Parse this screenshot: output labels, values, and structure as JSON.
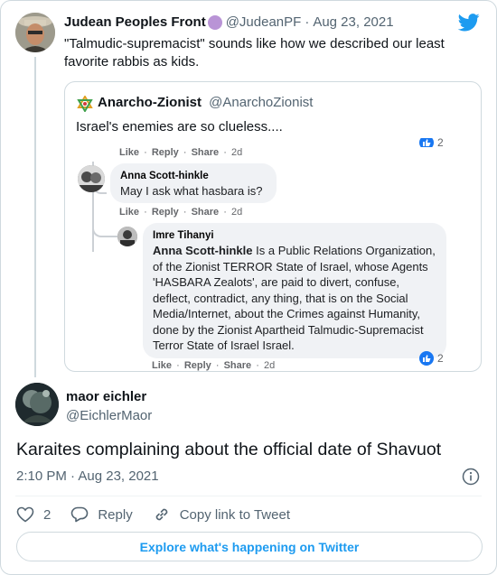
{
  "parent_tweet": {
    "name": "Judean Peoples Front",
    "handle": "@JudeanPF",
    "separator": "·",
    "date": "Aug 23, 2021",
    "text": "\"Talmudic-supremacist\" sounds like how we described our least favorite rabbis as kids."
  },
  "quoted": {
    "name": "Anarcho-Zionist",
    "handle": "@AnarchoZionist",
    "text": "Israel's enemies are so clueless....",
    "meta1": {
      "like": "Like",
      "reply": "Reply",
      "share": "Share",
      "sep": "·",
      "age": "2d"
    },
    "reaction1_count": "2",
    "comment1": {
      "author": "Anna Scott-hinkle",
      "text": "May I ask what hasbara is?",
      "meta": {
        "like": "Like",
        "reply": "Reply",
        "share": "Share",
        "sep": "·",
        "age": "2d"
      }
    },
    "comment2": {
      "author": "Imre Tihanyi",
      "mention": "Anna Scott-hinkle",
      "text": " Is a Public Relations Organization, of the Zionist TERROR State of Israel, whose Agents 'HASBARA Zealots', are paid to divert, confuse, deflect, contradict, any thing, that is on the Social Media/Internet, about the Crimes against Humanity, done by the Zionist Apartheid Talmudic-Supremacist Terror State of Israel Israel.",
      "meta": {
        "like": "Like",
        "reply": "Reply",
        "share": "Share",
        "sep": "·",
        "age": "2d"
      },
      "reaction_count": "2"
    }
  },
  "main_tweet": {
    "name": "maor eichler",
    "handle": "@EichlerMaor",
    "text": "Karaites complaining about the official date of Shavuot",
    "time": "2:10 PM · Aug 23, 2021",
    "likes": "2",
    "reply_label": "Reply",
    "copy_label": "Copy link to Tweet"
  },
  "explore_label": "Explore what's happening on Twitter",
  "colors": {
    "accent": "#1d9bf0",
    "fb_blue": "#1877f2",
    "secondary_text": "#536471"
  },
  "icons": [
    "twitter-bird-icon",
    "verified-purple-badge",
    "star-of-david-icon",
    "like-thumb-icon",
    "heart-icon",
    "reply-bubble-icon",
    "link-icon",
    "info-icon"
  ]
}
